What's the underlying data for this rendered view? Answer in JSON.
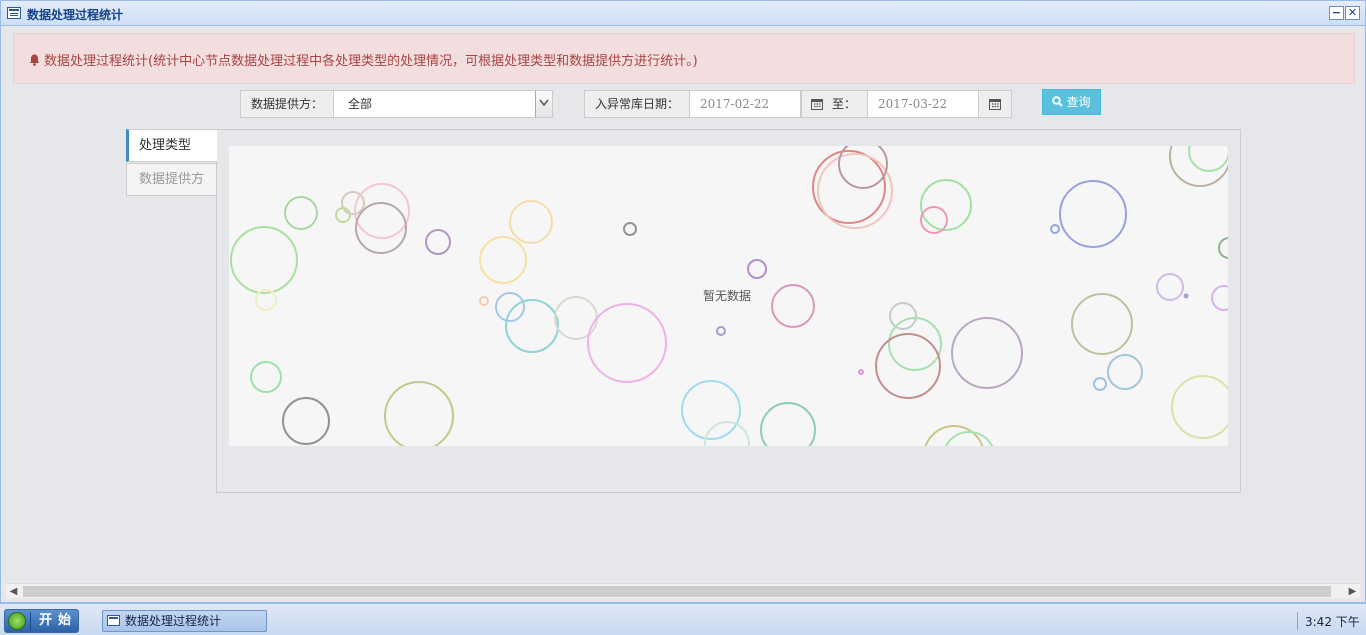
{
  "window": {
    "title": "数据处理过程统计",
    "minimize_icon": "minimize-icon",
    "close_icon": "close-icon"
  },
  "alert": {
    "icon": "bell-icon",
    "text": "数据处理过程统计(统计中心节点数据处理过程中各处理类型的处理情况，可根据处理类型和数据提供方进行统计。)",
    "color": "#a94442"
  },
  "filters": {
    "provider_label": "数据提供方：",
    "provider_value": "全部",
    "date_label": "入异常库日期：",
    "date_from": "2017-02-22",
    "to_label": "至：",
    "date_to": "2017-03-22",
    "query_label": "查询",
    "query_color": "#5bc0de"
  },
  "tabs": [
    {
      "label": "处理类型",
      "active": true
    },
    {
      "label": "数据提供方",
      "active": false
    }
  ],
  "chart": {
    "empty_text": "暂无数据"
  },
  "taskbar": {
    "start_label": "开始",
    "task_label": "数据处理过程统计",
    "clock": "3:42 下午"
  }
}
